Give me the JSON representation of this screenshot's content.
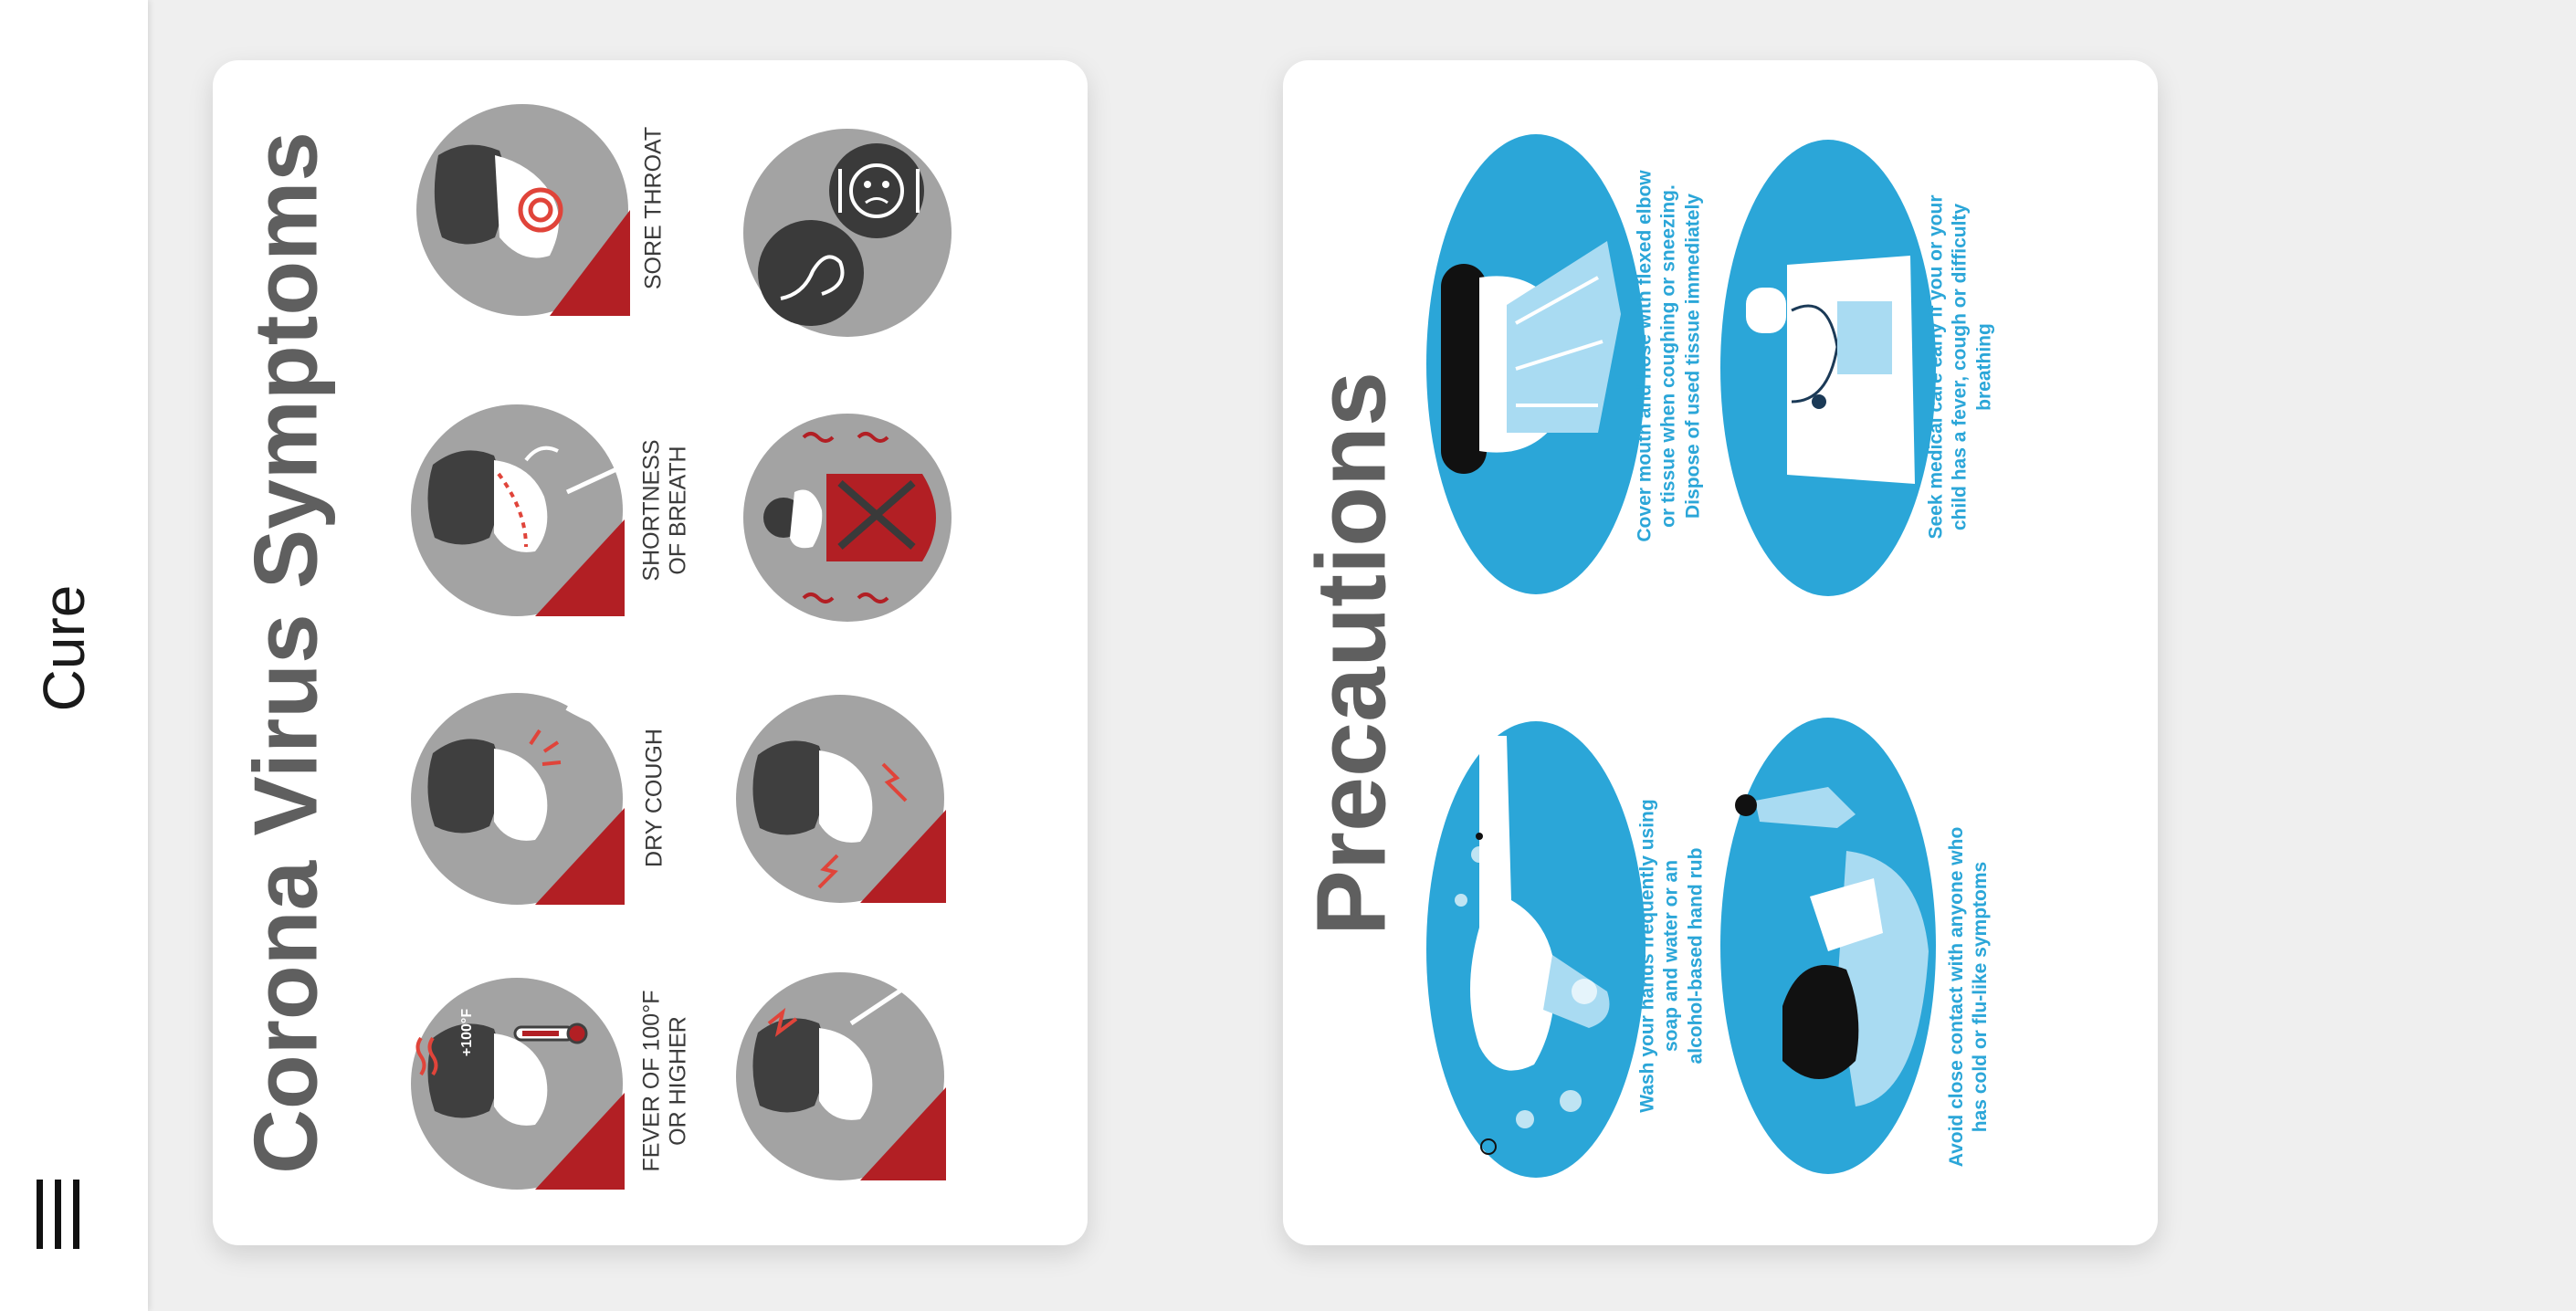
{
  "app": {
    "title": "Cure"
  },
  "symptoms": {
    "title": "Corona Virus Symptoms",
    "items": [
      {
        "label": "SORE THROAT"
      },
      {
        "label": "SHORTNESS\nOF BREATH"
      },
      {
        "label": "DRY COUGH"
      },
      {
        "label": "FEVER OF 100°F\nOR HIGHER"
      },
      {
        "label": "+100°F"
      }
    ]
  },
  "precautions": {
    "title": "Precautions",
    "items": [
      {
        "text": "Cover mouth and nose with flexed elbow\nor tissue when coughing or sneezing.\nDispose of used tissue immediately"
      },
      {
        "text": "Seek medical care early if you or your\nchild has a fever, cough or difficulty\nbreathing"
      },
      {
        "text": "Wash your hands frequently using\nsoap and water or an\nalcohol-based hand rub"
      },
      {
        "text": "Avoid close contact with anyone who\nhas cold or flu-like symptoms"
      }
    ]
  },
  "colors": {
    "accent_red": "#b21f24",
    "circle_gray": "#a3a3a3",
    "precaution_blue": "#2ba6d8",
    "title_gray": "#5f5f5f"
  }
}
